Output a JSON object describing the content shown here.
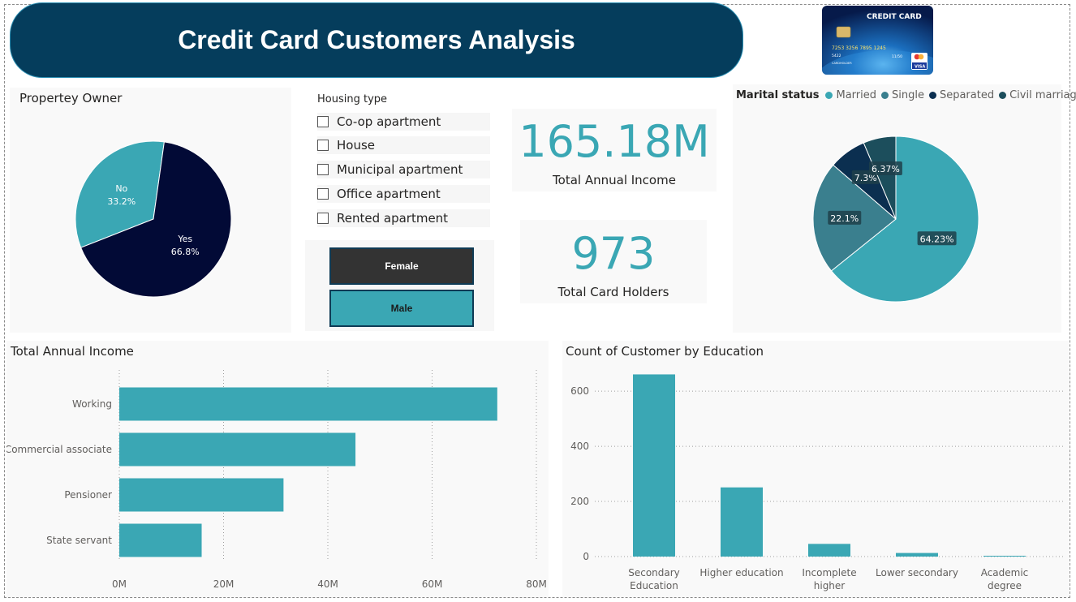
{
  "header": {
    "title": "Credit Card Customers Analysis"
  },
  "card_image": {
    "label": "CREDIT CARD",
    "number": "7253 3256 7895 1245",
    "digits": "5422",
    "expiry": "11/50",
    "holder": "CARDHOLDER",
    "brand": "VISA"
  },
  "property_owner": {
    "title": "Propertey Owner",
    "chart_data": {
      "type": "pie",
      "slices": [
        {
          "label": "No",
          "value": 33.2,
          "text": "33.2%",
          "color": "#3aa7b4"
        },
        {
          "label": "Yes",
          "value": 66.8,
          "text": "66.8%",
          "color": "#020a36"
        }
      ]
    }
  },
  "housing": {
    "title": "Housing type",
    "items": [
      {
        "label": "Co-op apartment"
      },
      {
        "label": "House"
      },
      {
        "label": "Municipal apartment"
      },
      {
        "label": "Office apartment"
      },
      {
        "label": "Rented apartment"
      }
    ]
  },
  "gender": {
    "female": "Female",
    "male": "Male"
  },
  "kpi": {
    "income": {
      "value": "165.18M",
      "label": "Total Annual Income"
    },
    "holders": {
      "value": "973",
      "label": "Total Card Holders"
    }
  },
  "marital": {
    "legend_title": "Marital status",
    "chart_data": {
      "type": "pie",
      "slices": [
        {
          "label": "Married",
          "value": 64.23,
          "text": "64.23%",
          "color": "#3aa7b4"
        },
        {
          "label": "Single",
          "value": 22.1,
          "text": "22.1%",
          "color": "#3a7f8e"
        },
        {
          "label": "Separated",
          "value": 7.3,
          "text": "7.3%",
          "color": "#0b2f50"
        },
        {
          "label": "Civil marriage",
          "value": 6.37,
          "text": "6.37%",
          "color": "#1c4e5c"
        }
      ]
    }
  },
  "income_chart": {
    "title": "Total Annual Income",
    "chart_data": {
      "type": "bar",
      "orientation": "horizontal",
      "categories": [
        "Working",
        "Commercial associate",
        "Pensioner",
        "State servant"
      ],
      "values": [
        72.5,
        45.3,
        31.5,
        15.8
      ],
      "xlim": [
        0,
        80
      ],
      "ticks": [
        0,
        20,
        40,
        60,
        80
      ],
      "tick_labels": [
        "0M",
        "20M",
        "40M",
        "60M",
        "80M"
      ],
      "color": "#3aa7b4",
      "grid": true
    }
  },
  "education_chart": {
    "title": "Count of Customer by Education",
    "chart_data": {
      "type": "bar",
      "categories": [
        "Secondary Education",
        "Higher education",
        "Incomplete higher",
        "Lower secondary",
        "Academic degree"
      ],
      "values": [
        661,
        251,
        46,
        13,
        2
      ],
      "ylim": [
        0,
        680
      ],
      "ticks": [
        0,
        200,
        400,
        600
      ],
      "tick_labels": [
        "0",
        "200",
        "400",
        "600"
      ],
      "color": "#3aa7b4",
      "grid": true
    }
  }
}
